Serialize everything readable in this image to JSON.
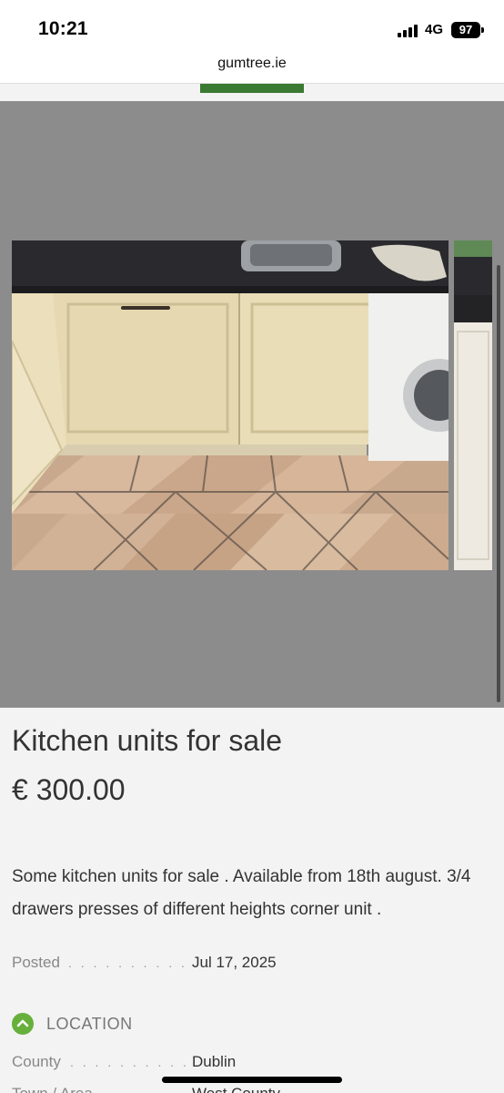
{
  "status_bar": {
    "time": "10:21",
    "network": "4G",
    "battery": "97"
  },
  "browser": {
    "url": "gumtree.ie"
  },
  "listing": {
    "title": "Kitchen units for sale",
    "price": "€ 300.00",
    "description": "Some kitchen units for sale . Available from 18th august. 3/4 drawers presses of different heights corner unit ."
  },
  "details": {
    "posted": {
      "label": "Posted",
      "dots": ". . . . . . . . . . . .",
      "value": "Jul 17, 2025"
    }
  },
  "location": {
    "title": "LOCATION",
    "county": {
      "label": "County",
      "dots": ". . . . . . . . . . . .",
      "value": "Dublin"
    },
    "town": {
      "label": "Town / Area",
      "value": "West County"
    }
  },
  "icons": {
    "location_toggle": "chevron-up-icon",
    "signal": "signal-icon",
    "battery": "battery-icon"
  },
  "colors": {
    "accent_green": "#67b03c",
    "gallery_bg": "#8c8c8c",
    "page_bg": "#f3f3f3"
  }
}
